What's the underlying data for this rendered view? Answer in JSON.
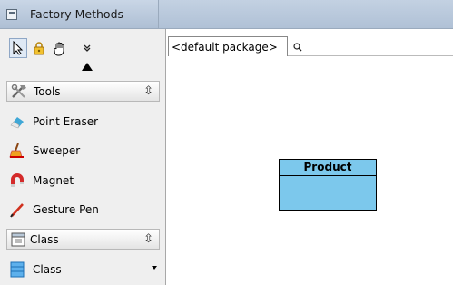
{
  "window": {
    "title": "Factory Methods"
  },
  "toolbar": {
    "buttons": [
      {
        "name": "select-arrow-icon"
      },
      {
        "name": "lock-icon"
      },
      {
        "name": "hand-icon"
      },
      {
        "name": "more-chevron-icon"
      }
    ]
  },
  "sections": [
    {
      "label": "Tools",
      "items": [
        {
          "label": "Point Eraser",
          "icon": "eraser-icon"
        },
        {
          "label": "Sweeper",
          "icon": "sweeper-icon"
        },
        {
          "label": "Magnet",
          "icon": "magnet-icon"
        },
        {
          "label": "Gesture Pen",
          "icon": "pen-icon"
        }
      ]
    },
    {
      "label": "Class",
      "items": [
        {
          "label": "Class",
          "icon": "class-icon"
        }
      ]
    }
  ],
  "diagram_tab": {
    "label": "<default package>"
  },
  "diagram": {
    "classes": [
      {
        "name": "Product",
        "fill": "#7cc8ec"
      }
    ]
  },
  "colors": {
    "titlebar": "#b9c9dc",
    "palette_bg": "#efefef",
    "class_fill": "#7cc8ec"
  }
}
